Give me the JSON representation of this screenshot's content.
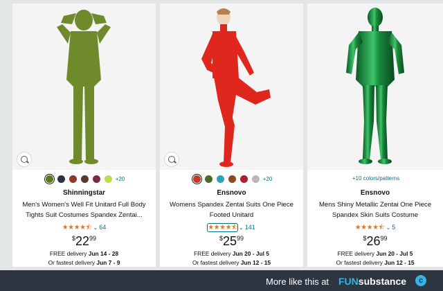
{
  "products": [
    {
      "brand": "Shinningstar",
      "title_line1": "Men's Women's Well Fit Unitard Full Body",
      "title_line2": "Tights Suit Costumes Spandex Zentai...",
      "stars": "★★★★⯪",
      "rating_count": "64",
      "price_currency": "$",
      "price_whole": "22",
      "price_fraction": "99",
      "delivery_free_label": "FREE delivery ",
      "delivery_free_dates": "Jun 14 - 28",
      "delivery_fast_label": "Or fastest delivery ",
      "delivery_fast_dates": "Jun 7 - 9",
      "more_colors": "+20",
      "swatch_colors": [
        "#5b7a1e",
        "#2a3244",
        "#8e3b2a",
        "#5a3a2a",
        "#7a2a4a",
        "#b7e046"
      ],
      "suit_color": "#6f8a2a"
    },
    {
      "brand": "Ensnovo",
      "title_line1": "Womens Spandex Zentai Suits One Piece",
      "title_line2": "Footed Unitard",
      "stars": "★★★★⯪",
      "rating_count": "141",
      "price_currency": "$",
      "price_whole": "25",
      "price_fraction": "99",
      "delivery_free_label": "FREE delivery ",
      "delivery_free_dates": "Jun 20 - Jul 5",
      "delivery_fast_label": "Or fastest delivery ",
      "delivery_fast_dates": "Jun 12 - 15",
      "more_colors": "+20",
      "swatch_colors": [
        "#c8381e",
        "#4a6a2a",
        "#2aa0c8",
        "#8e4a1e",
        "#b01e2a",
        "#b8b8b8"
      ],
      "suit_color": "#e0271e"
    },
    {
      "brand": "Ensnovo",
      "title_line1": "Mens Shiny Metallic Zentai One Piece",
      "title_line2": "Spandex Skin Suits Costume",
      "stars": "★★★★⯪",
      "rating_count": "5",
      "price_currency": "$",
      "price_whole": "26",
      "price_fraction": "99",
      "delivery_free_label": "FREE delivery ",
      "delivery_free_dates": "Jun 20 - Jul 5",
      "delivery_fast_label": "Or fastest delivery ",
      "delivery_fast_dates": "Jun 12 - 15",
      "more_colors": "+10 colors/patterns",
      "swatch_colors": [],
      "suit_color": "#1a8a3e"
    }
  ],
  "footer": {
    "more_text": "More like this at",
    "logo_fun": "FUN",
    "logo_rest": "substance",
    "logo_mark": "c"
  }
}
